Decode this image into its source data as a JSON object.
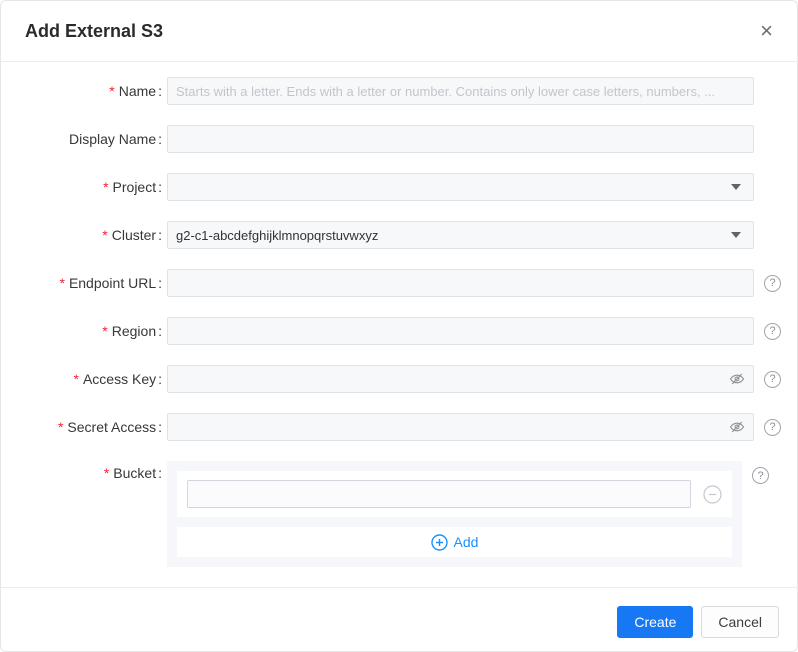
{
  "modal": {
    "title": "Add External S3"
  },
  "icons": {
    "close": "×",
    "help": "?"
  },
  "form": {
    "required_marker": "*",
    "fields": [
      {
        "label": "Name",
        "required": true,
        "control": "text",
        "placeholder": "Starts with a letter. Ends with a letter or number. Contains only lower case letters, numbers, ...",
        "value": ""
      },
      {
        "label": "Display Name",
        "required": false,
        "control": "text",
        "placeholder": "",
        "value": ""
      },
      {
        "label": "Project",
        "required": true,
        "control": "select",
        "value": ""
      },
      {
        "label": "Cluster",
        "required": true,
        "control": "select",
        "value": "g2-c1-abcdefghijklmnopqrstuvwxyz"
      },
      {
        "label": "Endpoint URL",
        "required": true,
        "control": "text",
        "placeholder": "",
        "value": "",
        "has_help": true
      },
      {
        "label": "Region",
        "required": true,
        "control": "text",
        "placeholder": "",
        "value": "",
        "has_help": true
      },
      {
        "label": "Access Key",
        "required": true,
        "control": "password",
        "placeholder": "",
        "value": "",
        "has_help": true
      },
      {
        "label": "Secret Access",
        "required": true,
        "control": "password",
        "placeholder": "",
        "value": "",
        "has_help": true
      },
      {
        "label": "Bucket",
        "required": true,
        "control": "bucket_list",
        "has_help": true
      }
    ],
    "bucket": {
      "items": [
        {
          "value": ""
        }
      ],
      "add_label": "Add"
    }
  },
  "footer": {
    "create_label": "Create",
    "cancel_label": "Cancel"
  },
  "colors": {
    "accent_blue": "#1678f3",
    "link_blue": "#1890ff",
    "required_red": "#f5222d"
  }
}
